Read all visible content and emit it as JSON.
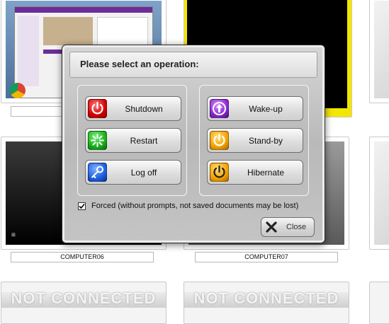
{
  "tiles": [
    {
      "label": "COMPUTER06"
    },
    {
      "label": "COMPUTER07"
    }
  ],
  "not_connected_text": "NOT CONNECTED",
  "dialog": {
    "title": "Please select an operation:",
    "left_ops": [
      {
        "label": "Shutdown",
        "icon": "power-icon",
        "color": "#d60000"
      },
      {
        "label": "Restart",
        "icon": "restart-icon",
        "color": "#19b019"
      },
      {
        "label": "Log off",
        "icon": "key-icon",
        "color": "#1f5fe0"
      }
    ],
    "right_ops": [
      {
        "label": "Wake-up",
        "icon": "wake-up-arrow-icon",
        "color": "#8a2bd2"
      },
      {
        "label": "Stand-by",
        "icon": "power-icon",
        "color": "#f3a300"
      },
      {
        "label": "Hibernate",
        "icon": "power-icon",
        "color": "#f3a300"
      }
    ],
    "forced_checked": true,
    "forced_label": "Forced (without prompts, not saved documents may be lost)",
    "close_label": "Close"
  }
}
